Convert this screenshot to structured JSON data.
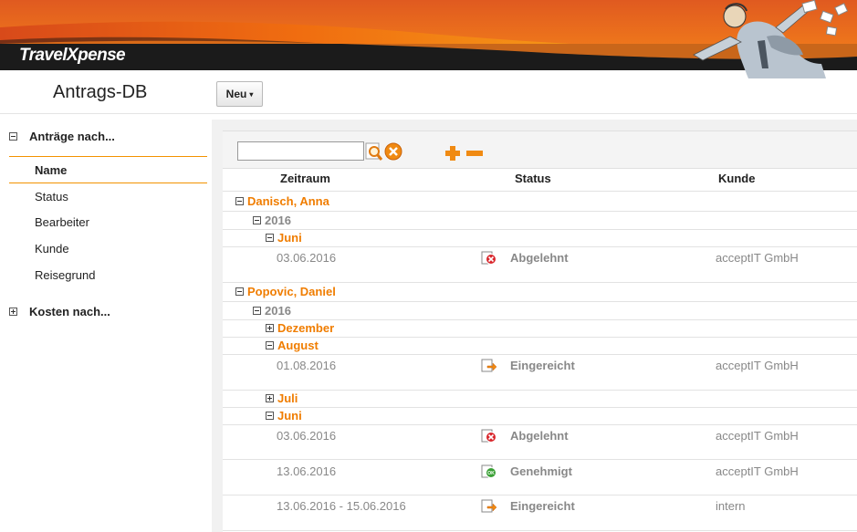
{
  "app": {
    "logo_text": "TravelXpense"
  },
  "header": {
    "page_title": "Antrags-DB",
    "new_button_label": "Neu",
    "new_button_caret": "▾"
  },
  "sidebar": {
    "group_requests": "Anträge nach...",
    "items": [
      {
        "label": "Name",
        "active": true
      },
      {
        "label": "Status"
      },
      {
        "label": "Bearbeiter"
      },
      {
        "label": "Kunde"
      },
      {
        "label": "Reisegrund"
      }
    ],
    "group_costs": "Kosten nach..."
  },
  "filter": {
    "search_value": "",
    "search_icon": "magnifier-icon",
    "clear_icon": "clear-icon",
    "expand_icon": "plus-icon",
    "collapse_icon": "minus-icon"
  },
  "columns": {
    "period": "Zeitraum",
    "status": "Status",
    "customer": "Kunde"
  },
  "tree": {
    "p1": {
      "name": "Danisch, Anna",
      "year": "2016",
      "m1": {
        "name": "Juni",
        "r1": {
          "period": "03.06.2016",
          "status": "Abgelehnt",
          "status_icon": "rejected-icon",
          "customer": "acceptIT GmbH"
        }
      }
    },
    "p2": {
      "name": "Popovic, Daniel",
      "year": "2016",
      "m1": {
        "name": "Dezember"
      },
      "m2": {
        "name": "August",
        "r1": {
          "period": "01.08.2016",
          "status": "Eingereicht",
          "status_icon": "submitted-icon",
          "customer": "acceptIT GmbH"
        }
      },
      "m3": {
        "name": "Juli"
      },
      "m4": {
        "name": "Juni",
        "r1": {
          "period": "03.06.2016",
          "status": "Abgelehnt",
          "status_icon": "rejected-icon",
          "customer": "acceptIT GmbH"
        },
        "r2": {
          "period": "13.06.2016",
          "status": "Genehmigt",
          "status_icon": "approved-icon",
          "customer": "acceptIT GmbH"
        },
        "r3": {
          "period": "13.06.2016 - 15.06.2016",
          "status": "Eingereicht",
          "status_icon": "submitted-icon",
          "customer": "intern"
        }
      }
    }
  },
  "colors": {
    "accent": "#f07d00",
    "accent_dark": "#e85d00",
    "banner_dark": "#1c1c1c"
  }
}
